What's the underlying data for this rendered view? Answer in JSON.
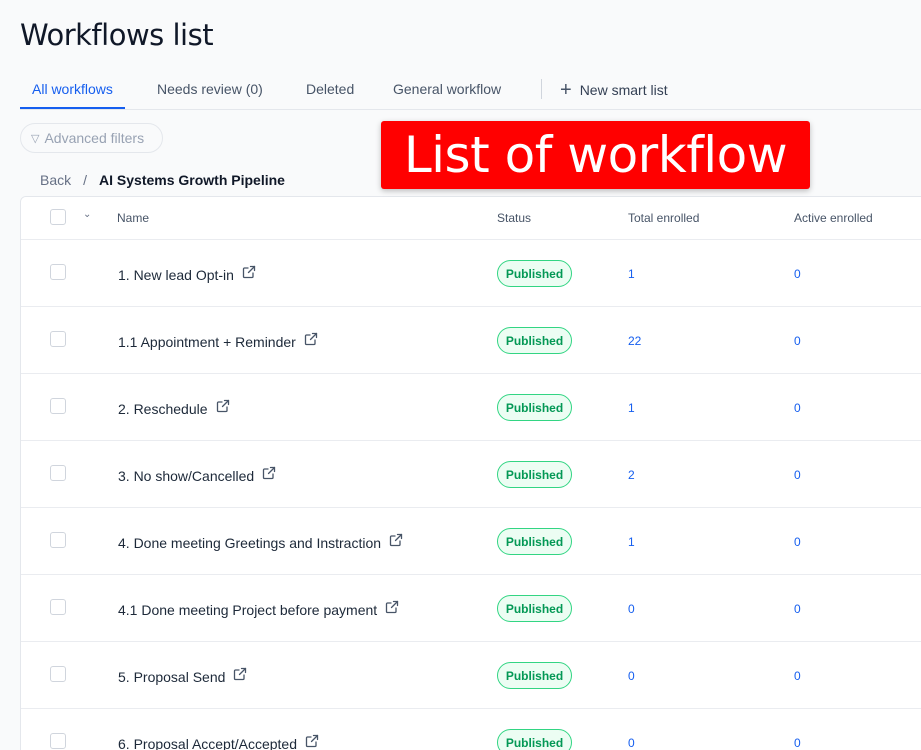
{
  "page": {
    "title": "Workflows list"
  },
  "tabs": [
    {
      "label": "All workflows",
      "active": true
    },
    {
      "label": "Needs review (0)",
      "active": false
    },
    {
      "label": "Deleted",
      "active": false
    },
    {
      "label": "General workflow",
      "active": false
    }
  ],
  "new_smart_list": {
    "label": "New smart list",
    "icon": "plus-icon"
  },
  "filters": {
    "label": "Advanced filters",
    "icon": "filter-icon"
  },
  "callout": {
    "text": "List of workflow"
  },
  "breadcrumb": {
    "back": "Back",
    "separator": "/",
    "current": "AI Systems Growth Pipeline"
  },
  "table": {
    "columns": {
      "name": "Name",
      "status": "Status",
      "total": "Total enrolled",
      "active": "Active enrolled"
    },
    "rows": [
      {
        "name": "1. New lead Opt-in",
        "status": "Published",
        "total": "1",
        "active": "0"
      },
      {
        "name": "1.1 Appointment + Reminder",
        "status": "Published",
        "total": "22",
        "active": "0"
      },
      {
        "name": "2. Reschedule",
        "status": "Published",
        "total": "1",
        "active": "0"
      },
      {
        "name": "3. No show/Cancelled",
        "status": "Published",
        "total": "2",
        "active": "0"
      },
      {
        "name": "4. Done meeting Greetings and Instraction",
        "status": "Published",
        "total": "1",
        "active": "0"
      },
      {
        "name": "4.1 Done meeting Project before payment",
        "status": "Published",
        "total": "0",
        "active": "0"
      },
      {
        "name": "5. Proposal Send",
        "status": "Published",
        "total": "0",
        "active": "0"
      },
      {
        "name": "6. Proposal Accept/Accepted",
        "status": "Published",
        "total": "0",
        "active": "0"
      }
    ]
  },
  "colors": {
    "accent": "#155eef",
    "published_text": "#039855",
    "published_border": "#32d583",
    "callout_bg": "#ff0000"
  }
}
